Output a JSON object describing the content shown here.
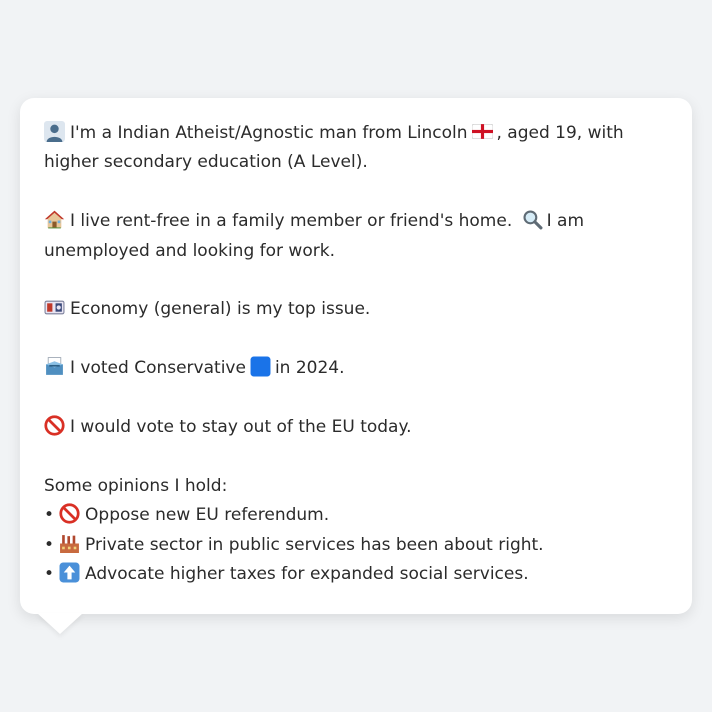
{
  "profile": {
    "line1_text": "I'm a Indian Atheist/Agnostic man from Lincoln",
    "line1_after_flag": ", aged 19, with higher secondary education (A Level).",
    "housing_text": "I live rent-free in a family member or friend's home.",
    "employment_text": "I am unemployed and looking for work.",
    "issue_text": "Economy (general) is my top issue.",
    "vote_before": "I voted Conservative",
    "vote_after": "in 2024.",
    "eu_text": "I would vote to stay out of the EU today.",
    "opinions_heading": "Some opinions I hold:",
    "opinions": [
      {
        "bullet": "•",
        "text": "Oppose new EU referendum.",
        "icon": "no-entry-icon"
      },
      {
        "bullet": "•",
        "text": "Private sector in public services has been about right.",
        "icon": "factory-icon"
      },
      {
        "bullet": "•",
        "text": "Advocate higher taxes for expanded social services.",
        "icon": "up-arrow-icon"
      }
    ]
  },
  "icons": {
    "person": "person-silhouette-icon",
    "flag": "england-flag-icon",
    "house": "house-icon",
    "search": "magnifier-icon",
    "economy": "money-icon",
    "ballot": "ballot-box-icon",
    "party": "blue-square-icon",
    "no_entry": "no-entry-icon"
  },
  "colors": {
    "background": "#f1f3f5",
    "card": "#ffffff",
    "text": "#2b2b2b",
    "conservative_blue": "#1a73e8",
    "no_entry_red": "#d93025"
  }
}
